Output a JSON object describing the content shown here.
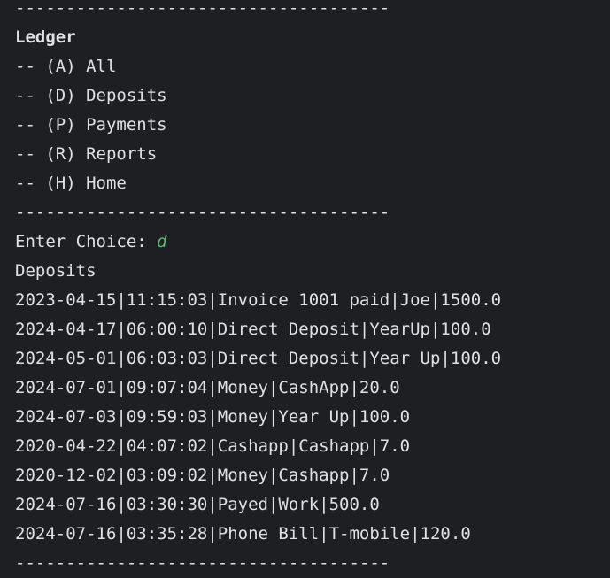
{
  "divider": "-------------------------------------",
  "menu": {
    "title": "Ledger",
    "items": [
      {
        "label": "-- (A) All"
      },
      {
        "label": "-- (D) Deposits"
      },
      {
        "label": "-- (P) Payments"
      },
      {
        "label": "-- (R) Reports"
      },
      {
        "label": "-- (H) Home"
      }
    ]
  },
  "prompt": {
    "label": "Enter Choice: ",
    "value": "d"
  },
  "results": {
    "heading": "Deposits",
    "rows": [
      "2023-04-15|11:15:03|Invoice 1001 paid|Joe|1500.0",
      "2024-04-17|06:00:10|Direct Deposit|YearUp|100.0",
      "2024-05-01|06:03:03|Direct Deposit|Year Up|100.0",
      "2024-07-01|09:07:04|Money|CashApp|20.0",
      "2024-07-03|09:59:03|Money|Year Up|100.0",
      "2020-04-22|04:07:02|Cashapp|Cashapp|7.0",
      "2020-12-02|03:09:02|Money|Cashapp|7.0",
      "2024-07-16|03:30:30|Payed|Work|500.0",
      "2024-07-16|03:35:28|Phone Bill|T-mobile|120.0"
    ]
  },
  "colors": {
    "background": "#1e1f22",
    "text": "#dfe1e5",
    "input": "#5fb86f"
  }
}
